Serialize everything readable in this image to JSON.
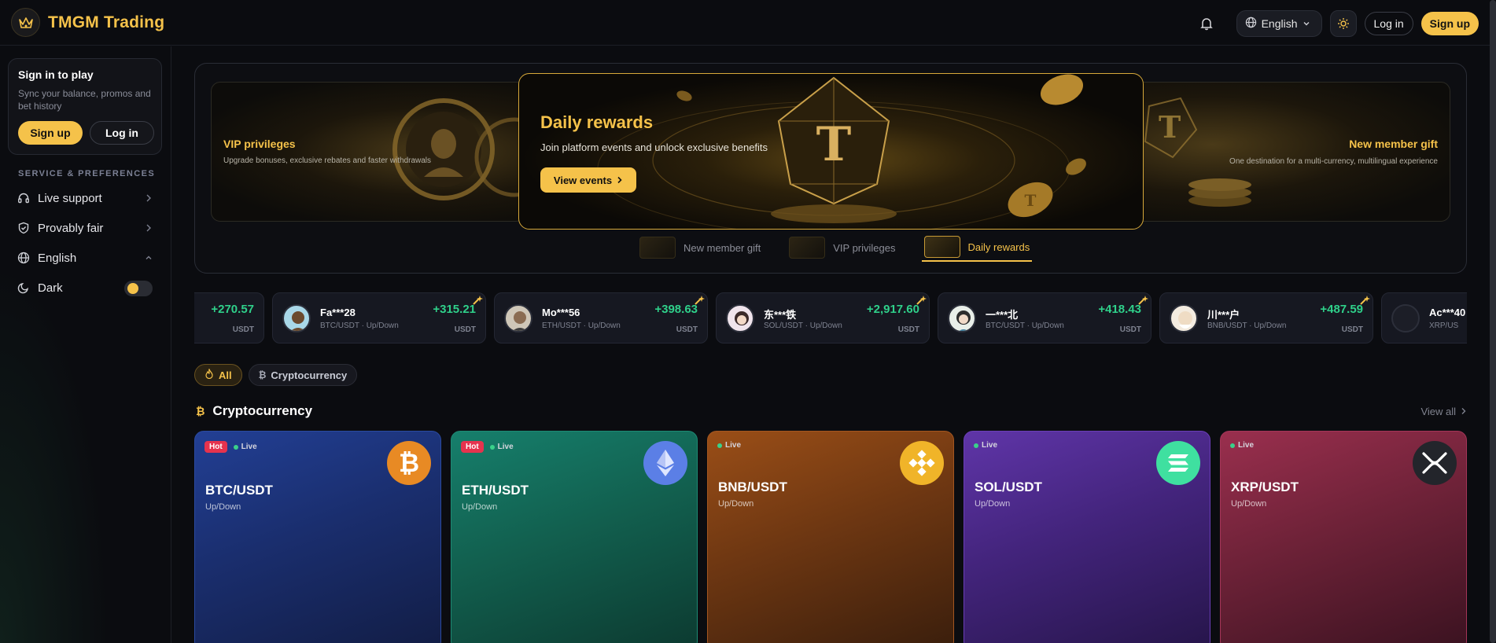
{
  "app": {
    "title": "TMGM Trading"
  },
  "topbar": {
    "language": "English",
    "login": "Log in",
    "signup": "Sign up"
  },
  "sidebar": {
    "signin_title": "Sign in to play",
    "signin_sub": "Sync your balance, promos and bet history",
    "signup": "Sign up",
    "login": "Log in",
    "section_label": "SERVICE & PREFERENCES",
    "items": [
      {
        "label": "Live support",
        "icon": "headset-icon"
      },
      {
        "label": "Provably fair",
        "icon": "shield-check-icon"
      },
      {
        "label": "English",
        "icon": "globe-icon"
      },
      {
        "label": "Dark",
        "icon": "moon-icon"
      }
    ],
    "dark_mode_on": true
  },
  "banner": {
    "left": {
      "title": "VIP privileges",
      "sub": "Upgrade bonuses, exclusive rebates and faster withdrawals"
    },
    "center": {
      "title": "Daily rewards",
      "sub": "Join platform events and unlock exclusive benefits",
      "button": "View events"
    },
    "right": {
      "title": "New member gift",
      "sub": "One destination for a multi-currency, multilingual experience"
    },
    "tabs": [
      "New member gift",
      "VIP privileges",
      "Daily rewards"
    ],
    "active_tab": 2
  },
  "ticker": {
    "partial_left": {
      "amount": "+270.57",
      "currency": "USDT"
    },
    "wins": [
      {
        "user": "Fa***28",
        "meta": "BTC/USDT · Up/Down",
        "amount": "+315.21",
        "currency": "USDT"
      },
      {
        "user": "Mo***56",
        "meta": "ETH/USDT · Up/Down",
        "amount": "+398.63",
        "currency": "USDT"
      },
      {
        "user": "东***铁",
        "meta": "SOL/USDT · Up/Down",
        "amount": "+2,917.60",
        "currency": "USDT"
      },
      {
        "user": "一***北",
        "meta": "BTC/USDT · Up/Down",
        "amount": "+418.43",
        "currency": "USDT"
      },
      {
        "user": "川***户",
        "meta": "BNB/USDT · Up/Down",
        "amount": "+487.59",
        "currency": "USDT"
      }
    ],
    "partial_right": {
      "user": "Ac***40",
      "meta": "XRP/US"
    }
  },
  "filters": [
    "All",
    "Cryptocurrency"
  ],
  "section": {
    "title": "Cryptocurrency",
    "view_all": "View all"
  },
  "cards": [
    {
      "pair": "BTC/USDT",
      "kind": "Up/Down",
      "hot": "Hot",
      "live": "Live",
      "color": "#1f3a8a"
    },
    {
      "pair": "ETH/USDT",
      "kind": "Up/Down",
      "hot": "Hot",
      "live": "Live",
      "color": "#137060"
    },
    {
      "pair": "BNB/USDT",
      "kind": "Up/Down",
      "live": "Live",
      "color": "#8a4516"
    },
    {
      "pair": "SOL/USDT",
      "kind": "Up/Down",
      "live": "Live",
      "color": "#5a2f9a"
    },
    {
      "pair": "XRP/USDT",
      "kind": "Up/Down",
      "live": "Live",
      "color": "#8a2a46"
    }
  ]
}
